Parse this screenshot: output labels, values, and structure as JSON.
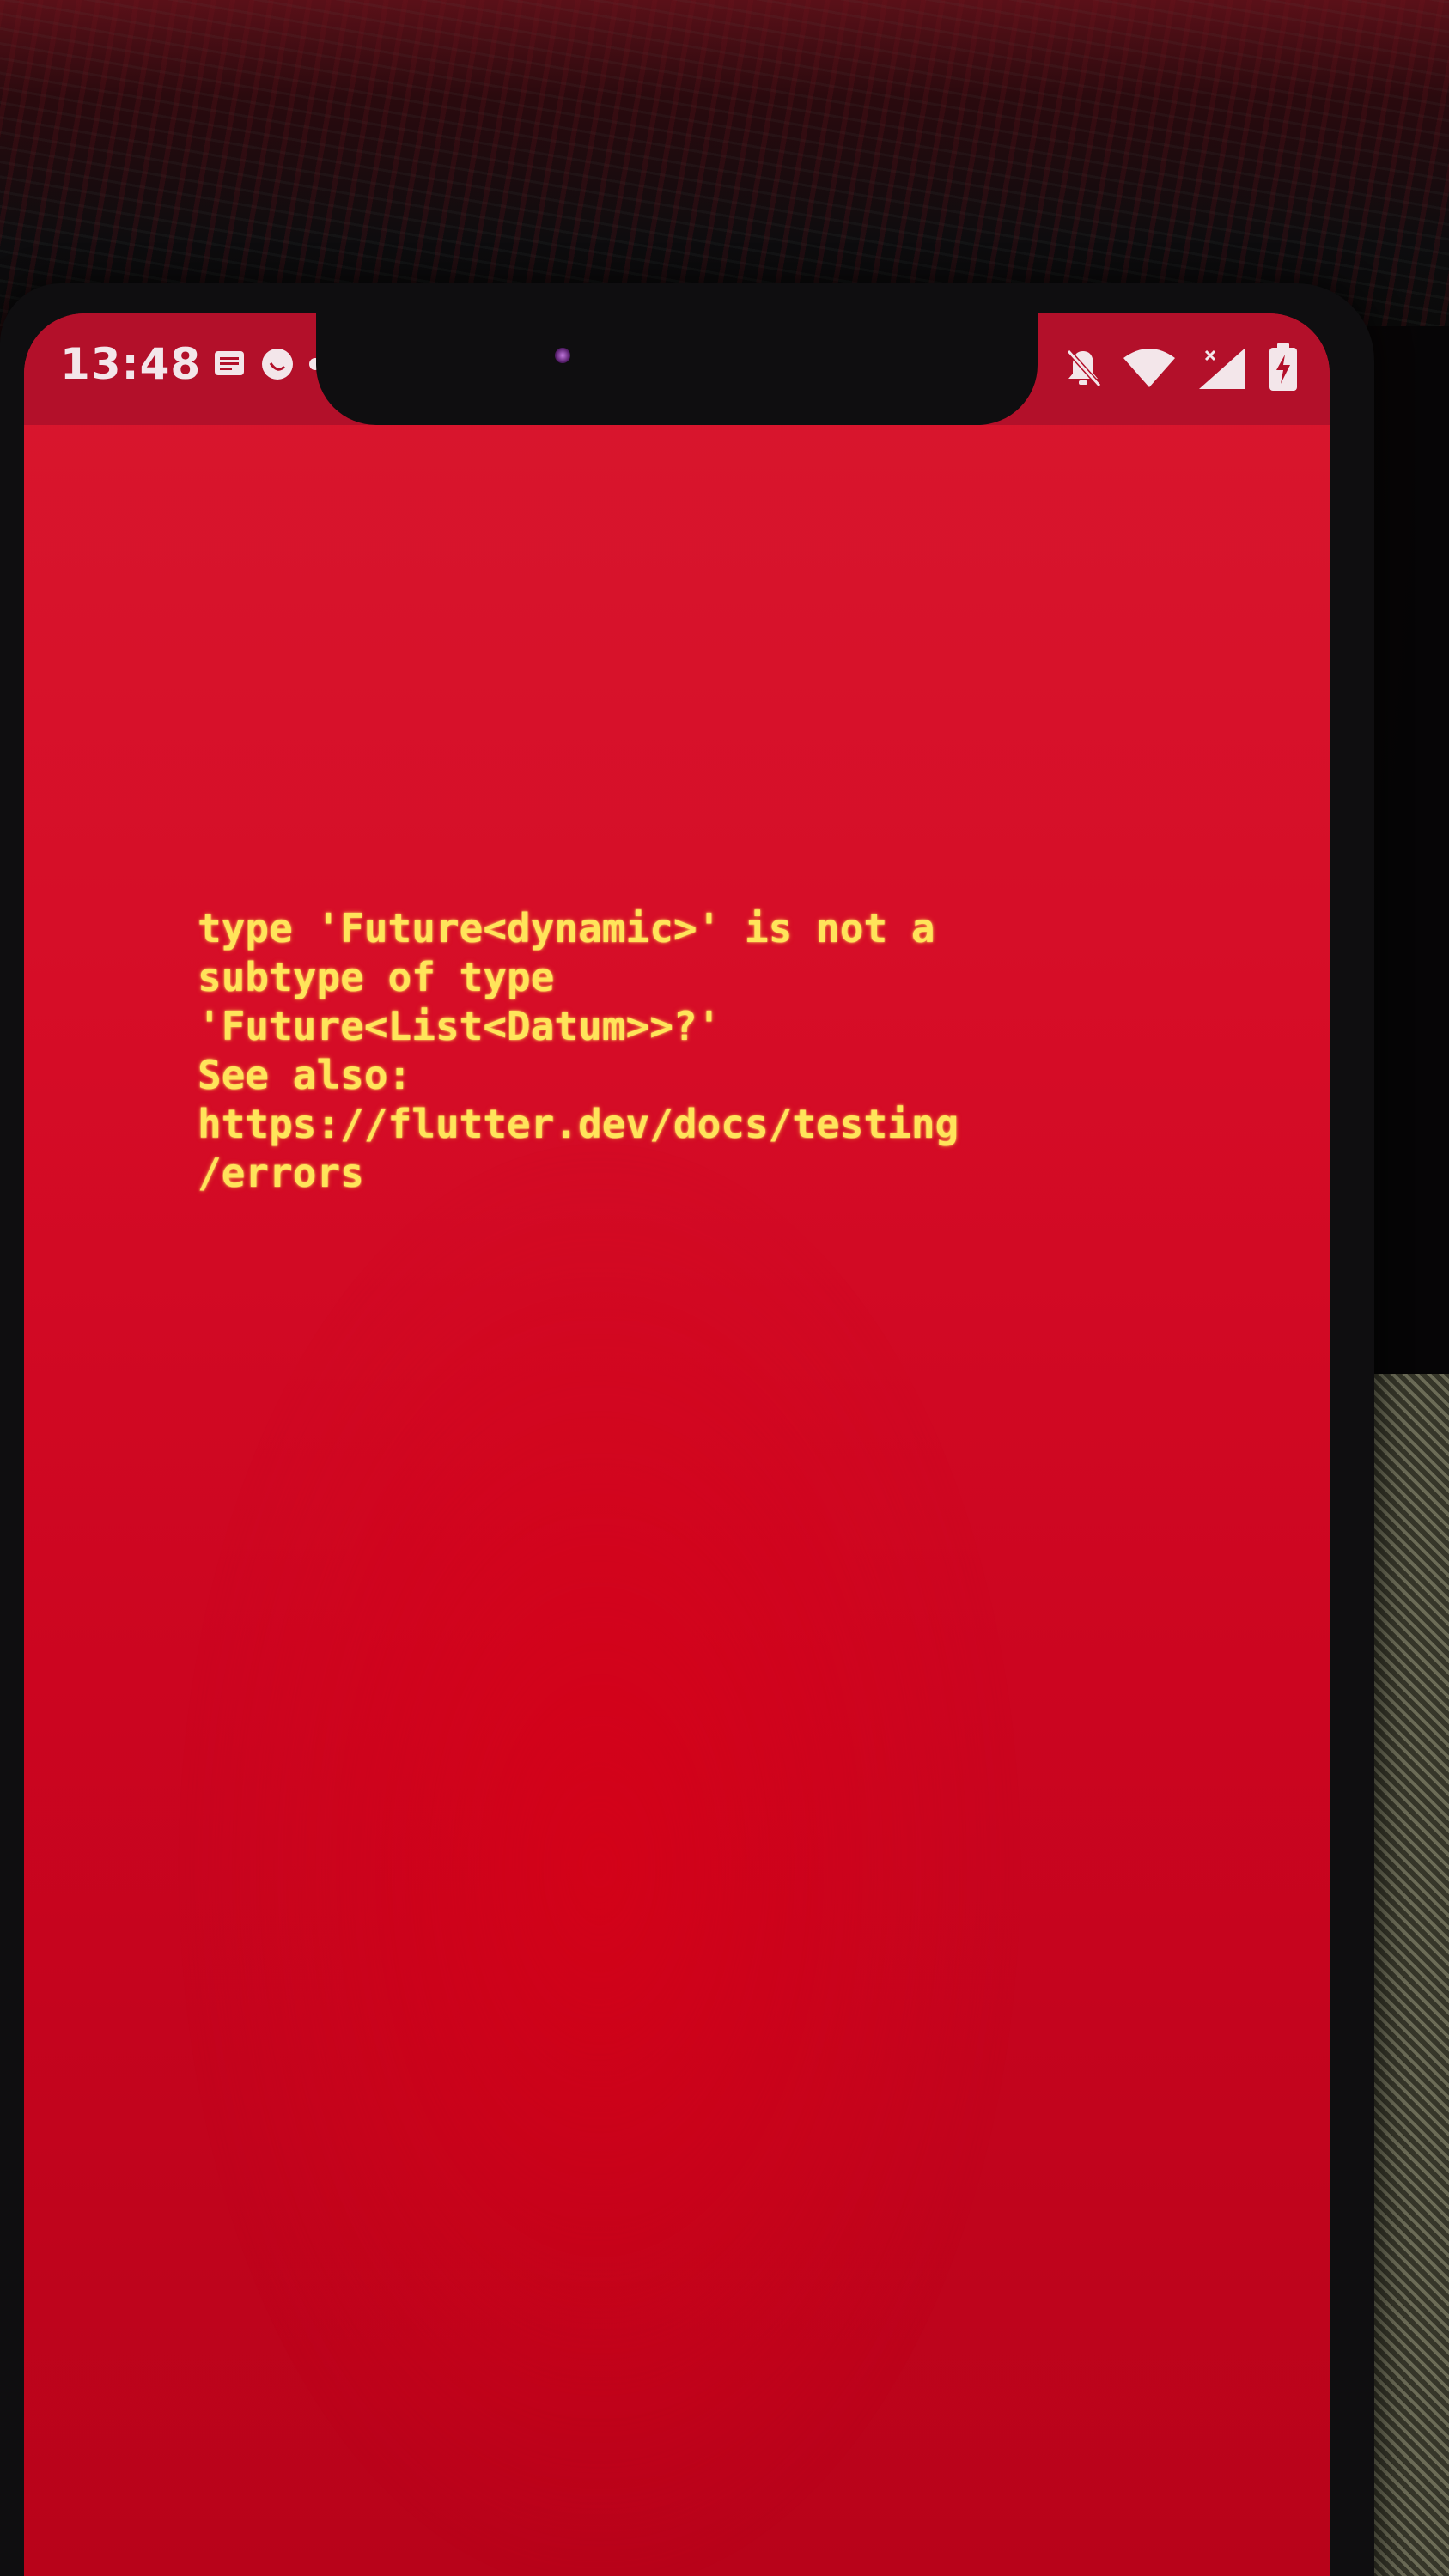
{
  "status_bar": {
    "time": "13:48",
    "left_icons": [
      "message-icon",
      "whatsapp-icon",
      "dot-icon"
    ],
    "right_icons": [
      "notifications-off-icon",
      "wifi-icon",
      "signal-icon",
      "battery-charging-icon"
    ]
  },
  "error_screen": {
    "background_color": "#d60d27",
    "text_color": "#ffe45a",
    "lines": [
      "type 'Future<dynamic>' is not a",
      "subtype of type",
      "'Future<List<Datum>>?'",
      "See also:",
      "https://flutter.dev/docs/testing",
      "/errors"
    ]
  }
}
